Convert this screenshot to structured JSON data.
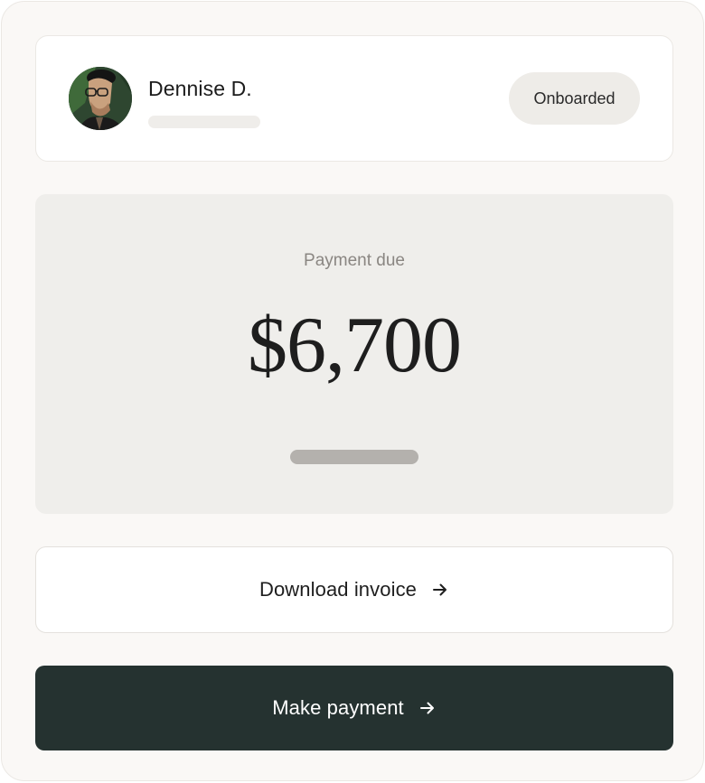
{
  "profile": {
    "name": "Dennise D.",
    "status": "Onboarded"
  },
  "payment": {
    "label": "Payment due",
    "amount": "$6,700"
  },
  "actions": {
    "download_label": "Download invoice",
    "pay_label": "Make payment"
  },
  "icons": {
    "download_arrow": "arrow-right-icon",
    "pay_arrow": "arrow-right-icon"
  },
  "colors": {
    "card_background": "#faf8f6",
    "panel_background": "#efeeeb",
    "badge_background": "#eeece8",
    "primary_button": "#253230",
    "primary_button_text": "#ffffff",
    "text_primary": "#1e1e1e",
    "text_muted": "#8a8682"
  }
}
